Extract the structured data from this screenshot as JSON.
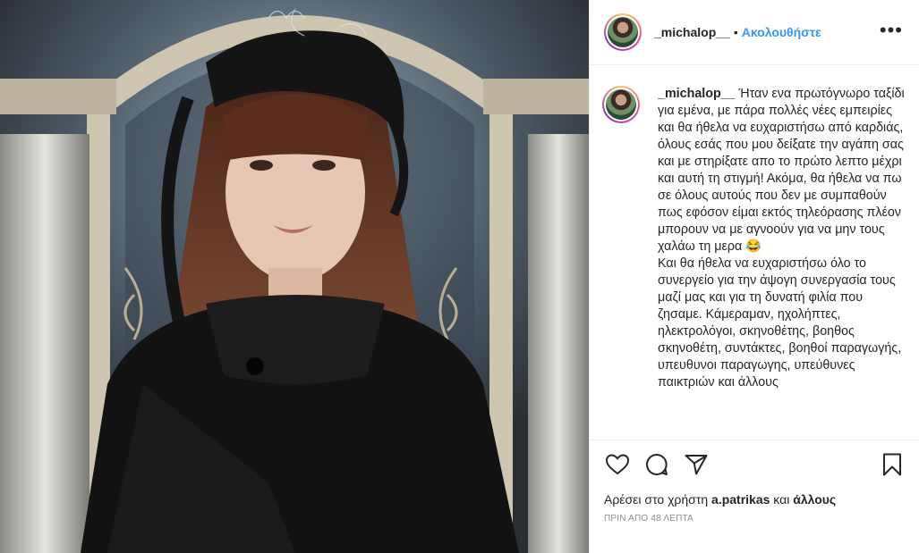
{
  "post": {
    "username": "_michalop__",
    "follow_label": "Ακολουθήστε",
    "dot": "•",
    "more_label": "•••",
    "caption_username": "_michalop__",
    "caption_text": "Ήταν ενα πρωτόγνωρο ταξίδι για εμένα, με πάρα πολλές νέες εμπειρίες και θα ήθελα να ευχαριστήσω από καρδιάς, όλους εσάς που μου δείξατε την αγάπη σας και με στηρίξατε απο το πρώτο λεπτο μέχρι και αυτή τη στιγμή! Ακόμα, θα ήθελα να πω σε όλους αυτούς που δεν με συμπαθούν πως εφόσον είμαι εκτός τηλεόρασης πλέον μπορουν να με αγνοούν για να μην τους χαλάω τη μερα 😂\nΚαι θα ήθελα να ευχαριστήσω όλο το συνεργείο για την άψογη συνεργασία τους μαζί μας και για τη δυνατή φιλία που ζησαμε. Κάμεραμαν, ηχολήπτες, ηλεκτρολόγοι, σκηνοθέτης, βοηθος σκηνοθέτη, συντάκτες, βοηθοί παραγωγής, υπευθυνοι παραγωγης, υπεύθυνες παικτριών και άλλους",
    "likes_prefix": "Αρέσει στο χρήστη ",
    "likes_user": "a.patrikas",
    "likes_middle": " και ",
    "likes_others": "άλλους",
    "timestamp": "ΠΡΙΝ ΑΠΟ 48 ΛΕΠΤΑ"
  },
  "icons": {
    "like": "heart-icon",
    "comment": "comment-icon",
    "share": "share-icon",
    "save": "bookmark-icon",
    "more": "more-options-icon"
  },
  "colors": {
    "follow": "#3897f0",
    "text": "#262626",
    "muted": "#8e8e8e",
    "border": "#efefef"
  }
}
